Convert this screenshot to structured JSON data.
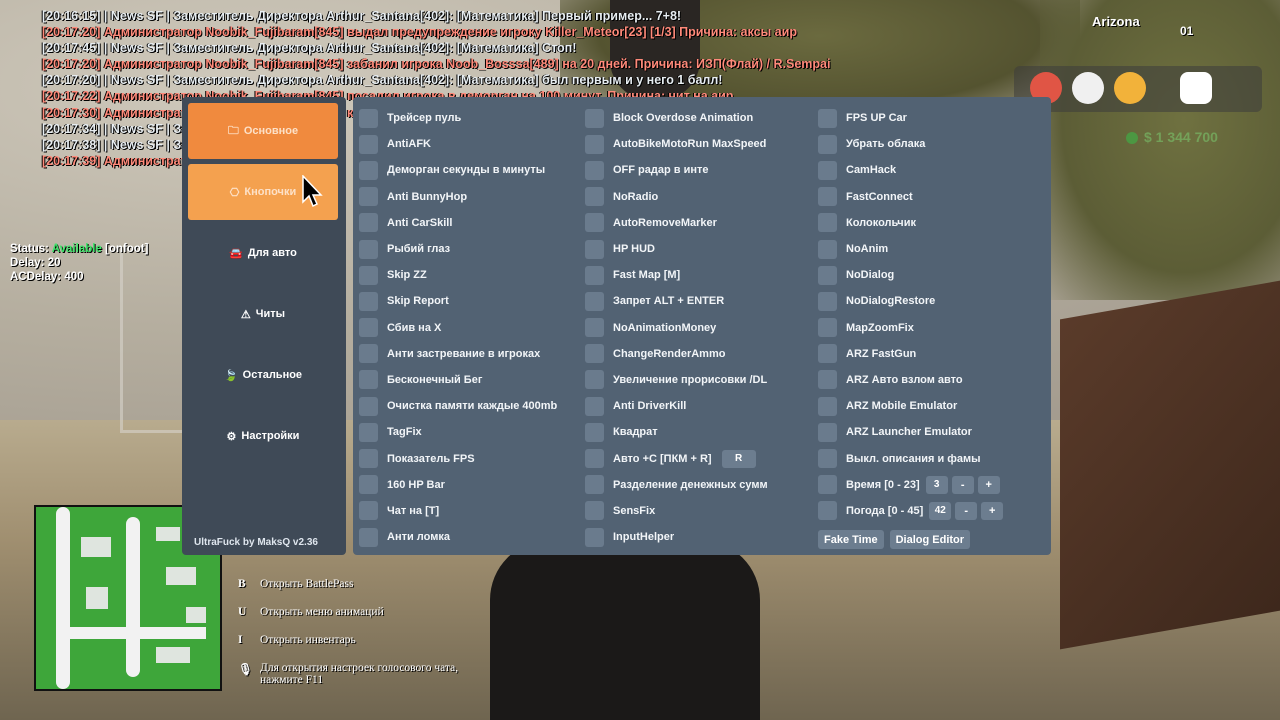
{
  "chat": [
    {
      "type": "news",
      "text": "[20:16:15] | News SF | Заместитель Директора Arthur_Santana[402]: [Математика] Первый пример... 7+8!"
    },
    {
      "type": "admin",
      "text": "[20:17:20] Администратор Noobik_Fujibaram[845] выдал предупреждение игроку Killer_Meteor[23] [1/3] Причина: аксы аир"
    },
    {
      "type": "news",
      "text": "[20:17:45] | News SF | Заместитель Директора Arthur_Santana[402]: [Математика] Стоп!"
    },
    {
      "type": "admin",
      "text": "[20:17:20] Администратор Noobik_Fujibaram[845] забанил игрока Noob_Bosssa[489] на 20 дней. Причина: ИЗП(Флай) / R.Sempai"
    },
    {
      "type": "news",
      "text": "[20:17:20] | News SF | Заместитель Директора Arthur_Santana[402]: [Математика] был первым и у него 1 балл!"
    },
    {
      "type": "admin",
      "text": "[20:17:22] Администратор Noobik_Fujibaram[845] посадил игрока в деморган на 100 минут. Причина: чит на аир"
    },
    {
      "type": "admin",
      "text": "[20:17:30] Администратор Noobik_Fujibaram[845] кикнул игрока"
    },
    {
      "type": "news",
      "text": "[20:17:34] | News SF | Заместитель Директора"
    },
    {
      "type": "news",
      "text": "[20:17:38] | News SF | Заместитель Директора"
    },
    {
      "type": "admin",
      "text": "[20:17:39] Администратор Noobik_Fujibaram"
    }
  ],
  "status": {
    "status_label": "Status:",
    "status_value": "Available",
    "status_extra": "[onfoot]",
    "delay": "Delay: 20",
    "acdelay": "ACDelay: 400"
  },
  "hud": {
    "player_name": "Arizona",
    "player_num": "01",
    "money": "$ 1 344 700"
  },
  "sidebar": {
    "items": [
      {
        "icon": "folder-icon",
        "glyph": "🗀",
        "label": "Основное"
      },
      {
        "icon": "button-icon",
        "glyph": "⎔",
        "label": "Кнопочки"
      },
      {
        "icon": "car-icon",
        "glyph": "🚘",
        "label": "Для авто"
      },
      {
        "icon": "warning-icon",
        "glyph": "⚠",
        "label": "Читы"
      },
      {
        "icon": "leaf-icon",
        "glyph": "🍃",
        "label": "Остальное"
      },
      {
        "icon": "gear-icon",
        "glyph": "⚙",
        "label": "Настройки"
      }
    ],
    "version": "UltraFuck by MaksQ v2.36"
  },
  "columns": [
    [
      "Трейсер пуль",
      "AntiAFK",
      "Деморган секунды в минуты",
      "Anti BunnyHop",
      "Anti CarSkill",
      "Рыбий глаз",
      "Skip ZZ",
      "Skip Report",
      "Сбив на X",
      "Анти застревание в игроках",
      "Бесконечный Бег",
      "Очистка памяти каждые 400mb",
      "TagFix",
      "Показатель FPS",
      "160 HP Bar",
      "Чат на [T]",
      "Анти ломка"
    ],
    [
      "Block Overdose Animation",
      "AutoBikeMotoRun MaxSpeed",
      "OFF радар в инте",
      "NoRadio",
      "AutoRemoveMarker",
      "HP HUD",
      "Fast Map [M]",
      "Запрет ALT + ENTER",
      "NoAnimationMoney",
      "ChangeRenderAmmo",
      "Увеличение прорисовки /DL",
      "Anti DriverKill",
      "Квадрат",
      "Авто +C [ПКМ + R]",
      "Разделение денежных сумм",
      "SensFix",
      "InputHelper"
    ],
    [
      "FPS UP Car",
      "Убрать облака",
      "CamHack",
      "FastConnect",
      "Колокольчик",
      "NoAnim",
      "NoDialog",
      "NoDialogRestore",
      "MapZoomFix",
      "ARZ FastGun",
      "ARZ Авто взлом авто",
      "ARZ Mobile Emulator",
      "ARZ Launcher Emulator",
      "Выкл. описания и фамы",
      "Время [0 - 23]",
      "Погода [0 - 45]"
    ]
  ],
  "extras": {
    "auto_c_key": "R",
    "time_value": "3",
    "weather_value": "42",
    "minus": "-",
    "plus": "+"
  },
  "actions": {
    "fake_time": "Fake Time",
    "dialog_editor": "Dialog Editor"
  },
  "hints": [
    {
      "key": "B",
      "text": "Открыть BattlePass"
    },
    {
      "key": "U",
      "text": "Открыть меню анимаций"
    },
    {
      "key": "I",
      "text": "Открыть инвентарь"
    },
    {
      "key": "🎙",
      "text": "Для открытия настроек голосового чата, нажмите  F11"
    }
  ],
  "colors": {
    "accent_orange": "#f08a3e",
    "panel": "#526273",
    "sidebar": "#3f4a57",
    "chat_news": "#e8eef2",
    "chat_admin": "#ff8a7a"
  }
}
